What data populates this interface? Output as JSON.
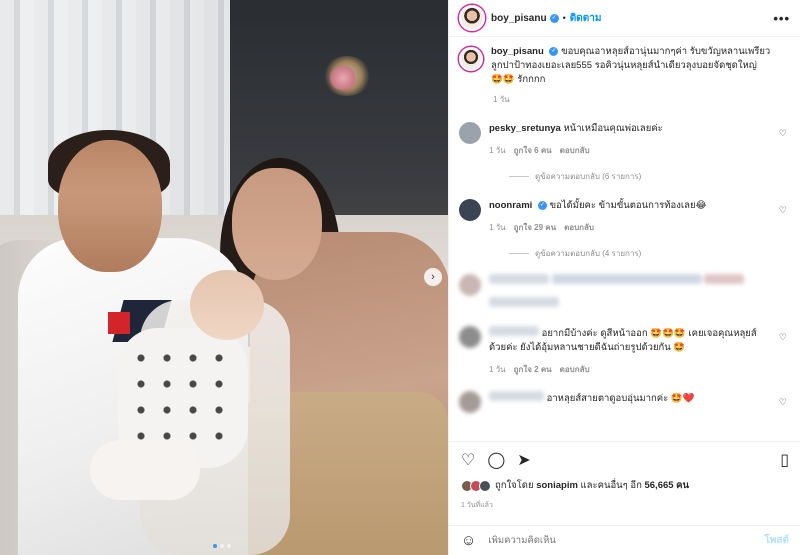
{
  "post": {
    "username": "boy_pisanu",
    "follow_label": "ติดตาม",
    "more_label": "•••",
    "caption": "ขอบคุณอาหลุยส์อานุ่นมากๆค่า รับขวัญหลานเพรียวลูกปาป้าทองเยอะเลย555 รอคิวนุ่นหลุยส์นำเดียวลุงบอยจัดชุดใหญ่ 🤩🤩 รักกกก",
    "caption_time": "1 วัน"
  },
  "comments": [
    {
      "username": "pesky_sretunya",
      "text": "หน้าเหมือนคุณพ่อเลยค่ะ",
      "time": "1 วัน",
      "likes": "ถูกใจ 6 คน",
      "reply_label": "ตอบกลับ",
      "view_replies": "ดูข้อความตอบกลับ (6 รายการ)",
      "avatar_color": "#9aa3ab"
    },
    {
      "username": "noonrami",
      "text": "ขอได้มั้ยคะ ข้ามขั้นตอนการท้องเลย😂",
      "time": "1 วัน",
      "likes": "ถูกใจ 29 คน",
      "reply_label": "ตอบกลับ",
      "view_replies": "ดูข้อความตอบกลับ (4 รายการ)",
      "avatar_color": "#3a4452"
    },
    {
      "text": "อยากมีบ้างค่ะ ดูสีหน้าออก 🤩🤩🤩 เคยเจอคุณหลุยส์ด้วยค่ะ ยังได้อุ้มหลานชายดีฉันถ่ายรูปด้วยกัน 🤩",
      "time": "1 วัน",
      "likes": "ถูกใจ 2 คน",
      "reply_label": "ตอบกลับ"
    },
    {
      "text": "อาหลุยส์สายตาดูอบอุ่นมากค่ะ 🤩❤️"
    }
  ],
  "footer": {
    "likes_prefix": "ถูกใจโดย",
    "liked_by": "soniapim",
    "likes_mid": "และคนอื่นๆ อีก",
    "likes_count": "56,665 คน",
    "timestamp": "1 วันที่แล้ว",
    "comment_placeholder": "เพิ่มความคิดเห็น",
    "post_label": "โพสต์"
  },
  "colors": {
    "accent": "#0095f6",
    "verified": "#3897f0",
    "muted": "#8e8e8e"
  },
  "icons": [
    "heart-icon",
    "comment-icon",
    "share-icon",
    "bookmark-icon",
    "emoji-icon",
    "more-icon",
    "verified-icon",
    "chevron-right-icon"
  ]
}
